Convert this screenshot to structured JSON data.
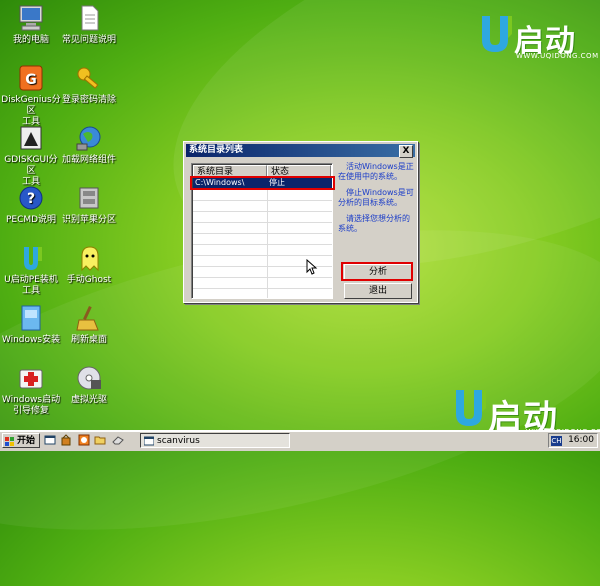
{
  "desktop": {
    "icons": [
      {
        "label": "我的电脑",
        "icon": "my-computer-icon"
      },
      {
        "label": "常见问题说明",
        "icon": "document-icon"
      },
      {
        "label": "DiskGenius分区\n工具",
        "icon": "diskgenius-icon"
      },
      {
        "label": "登录密码清除",
        "icon": "key-icon"
      },
      {
        "label": "GDISKGUI分区\n工具",
        "icon": "gdisk-icon"
      },
      {
        "label": "加载网络组件",
        "icon": "network-globe-icon"
      },
      {
        "label": "PECMD说明",
        "icon": "help-icon"
      },
      {
        "label": "识别苹果分区",
        "icon": "apple-partition-icon"
      },
      {
        "label": "U启动PE装机\n工具",
        "icon": "uqidong-installer-icon"
      },
      {
        "label": "手动Ghost",
        "icon": "ghost-icon"
      },
      {
        "label": "Windows安装",
        "icon": "windows-install-icon"
      },
      {
        "label": "刷新桌面",
        "icon": "broom-icon"
      },
      {
        "label": "Windows启动\n引导修复",
        "icon": "boot-repair-icon"
      },
      {
        "label": "虚拟光驱",
        "icon": "virtual-drive-icon"
      }
    ]
  },
  "logo": {
    "text": "启动",
    "url": "WWW.UQIDONG.COM"
  },
  "dialog": {
    "title": "系统目录列表",
    "close": "X",
    "columns": [
      "系统目录",
      "状态"
    ],
    "rows": [
      {
        "dir": "C:\\Windows\\",
        "status": "停止",
        "selected": true
      }
    ],
    "info": [
      "活动Windows是正在使用中的系统。",
      "停止Windows是可分析的目标系统。",
      "请选择您想分析的系统。"
    ],
    "analyze_label": "分析",
    "exit_label": "退出",
    "info_color": "#1a3cc8",
    "highlight_color": "#e00000"
  },
  "taskbar": {
    "start_label": "开始",
    "task_label": "scanvirus",
    "lang": "CH",
    "clock": "16:00"
  }
}
